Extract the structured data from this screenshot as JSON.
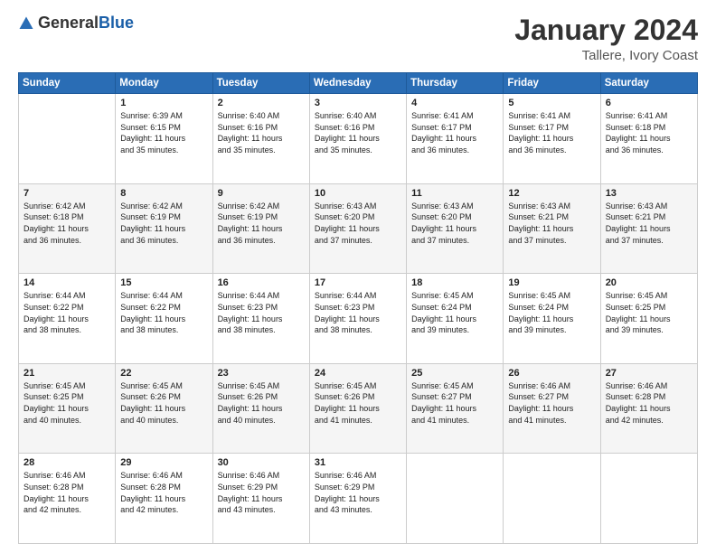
{
  "logo": {
    "general": "General",
    "blue": "Blue"
  },
  "title": "January 2024",
  "subtitle": "Tallere, Ivory Coast",
  "days_of_week": [
    "Sunday",
    "Monday",
    "Tuesday",
    "Wednesday",
    "Thursday",
    "Friday",
    "Saturday"
  ],
  "weeks": [
    [
      {
        "num": "",
        "info": ""
      },
      {
        "num": "1",
        "info": "Sunrise: 6:39 AM\nSunset: 6:15 PM\nDaylight: 11 hours\nand 35 minutes."
      },
      {
        "num": "2",
        "info": "Sunrise: 6:40 AM\nSunset: 6:16 PM\nDaylight: 11 hours\nand 35 minutes."
      },
      {
        "num": "3",
        "info": "Sunrise: 6:40 AM\nSunset: 6:16 PM\nDaylight: 11 hours\nand 35 minutes."
      },
      {
        "num": "4",
        "info": "Sunrise: 6:41 AM\nSunset: 6:17 PM\nDaylight: 11 hours\nand 36 minutes."
      },
      {
        "num": "5",
        "info": "Sunrise: 6:41 AM\nSunset: 6:17 PM\nDaylight: 11 hours\nand 36 minutes."
      },
      {
        "num": "6",
        "info": "Sunrise: 6:41 AM\nSunset: 6:18 PM\nDaylight: 11 hours\nand 36 minutes."
      }
    ],
    [
      {
        "num": "7",
        "info": "Sunrise: 6:42 AM\nSunset: 6:18 PM\nDaylight: 11 hours\nand 36 minutes."
      },
      {
        "num": "8",
        "info": "Sunrise: 6:42 AM\nSunset: 6:19 PM\nDaylight: 11 hours\nand 36 minutes."
      },
      {
        "num": "9",
        "info": "Sunrise: 6:42 AM\nSunset: 6:19 PM\nDaylight: 11 hours\nand 36 minutes."
      },
      {
        "num": "10",
        "info": "Sunrise: 6:43 AM\nSunset: 6:20 PM\nDaylight: 11 hours\nand 37 minutes."
      },
      {
        "num": "11",
        "info": "Sunrise: 6:43 AM\nSunset: 6:20 PM\nDaylight: 11 hours\nand 37 minutes."
      },
      {
        "num": "12",
        "info": "Sunrise: 6:43 AM\nSunset: 6:21 PM\nDaylight: 11 hours\nand 37 minutes."
      },
      {
        "num": "13",
        "info": "Sunrise: 6:43 AM\nSunset: 6:21 PM\nDaylight: 11 hours\nand 37 minutes."
      }
    ],
    [
      {
        "num": "14",
        "info": "Sunrise: 6:44 AM\nSunset: 6:22 PM\nDaylight: 11 hours\nand 38 minutes."
      },
      {
        "num": "15",
        "info": "Sunrise: 6:44 AM\nSunset: 6:22 PM\nDaylight: 11 hours\nand 38 minutes."
      },
      {
        "num": "16",
        "info": "Sunrise: 6:44 AM\nSunset: 6:23 PM\nDaylight: 11 hours\nand 38 minutes."
      },
      {
        "num": "17",
        "info": "Sunrise: 6:44 AM\nSunset: 6:23 PM\nDaylight: 11 hours\nand 38 minutes."
      },
      {
        "num": "18",
        "info": "Sunrise: 6:45 AM\nSunset: 6:24 PM\nDaylight: 11 hours\nand 39 minutes."
      },
      {
        "num": "19",
        "info": "Sunrise: 6:45 AM\nSunset: 6:24 PM\nDaylight: 11 hours\nand 39 minutes."
      },
      {
        "num": "20",
        "info": "Sunrise: 6:45 AM\nSunset: 6:25 PM\nDaylight: 11 hours\nand 39 minutes."
      }
    ],
    [
      {
        "num": "21",
        "info": "Sunrise: 6:45 AM\nSunset: 6:25 PM\nDaylight: 11 hours\nand 40 minutes."
      },
      {
        "num": "22",
        "info": "Sunrise: 6:45 AM\nSunset: 6:26 PM\nDaylight: 11 hours\nand 40 minutes."
      },
      {
        "num": "23",
        "info": "Sunrise: 6:45 AM\nSunset: 6:26 PM\nDaylight: 11 hours\nand 40 minutes."
      },
      {
        "num": "24",
        "info": "Sunrise: 6:45 AM\nSunset: 6:26 PM\nDaylight: 11 hours\nand 41 minutes."
      },
      {
        "num": "25",
        "info": "Sunrise: 6:45 AM\nSunset: 6:27 PM\nDaylight: 11 hours\nand 41 minutes."
      },
      {
        "num": "26",
        "info": "Sunrise: 6:46 AM\nSunset: 6:27 PM\nDaylight: 11 hours\nand 41 minutes."
      },
      {
        "num": "27",
        "info": "Sunrise: 6:46 AM\nSunset: 6:28 PM\nDaylight: 11 hours\nand 42 minutes."
      }
    ],
    [
      {
        "num": "28",
        "info": "Sunrise: 6:46 AM\nSunset: 6:28 PM\nDaylight: 11 hours\nand 42 minutes."
      },
      {
        "num": "29",
        "info": "Sunrise: 6:46 AM\nSunset: 6:28 PM\nDaylight: 11 hours\nand 42 minutes."
      },
      {
        "num": "30",
        "info": "Sunrise: 6:46 AM\nSunset: 6:29 PM\nDaylight: 11 hours\nand 43 minutes."
      },
      {
        "num": "31",
        "info": "Sunrise: 6:46 AM\nSunset: 6:29 PM\nDaylight: 11 hours\nand 43 minutes."
      },
      {
        "num": "",
        "info": ""
      },
      {
        "num": "",
        "info": ""
      },
      {
        "num": "",
        "info": ""
      }
    ]
  ]
}
